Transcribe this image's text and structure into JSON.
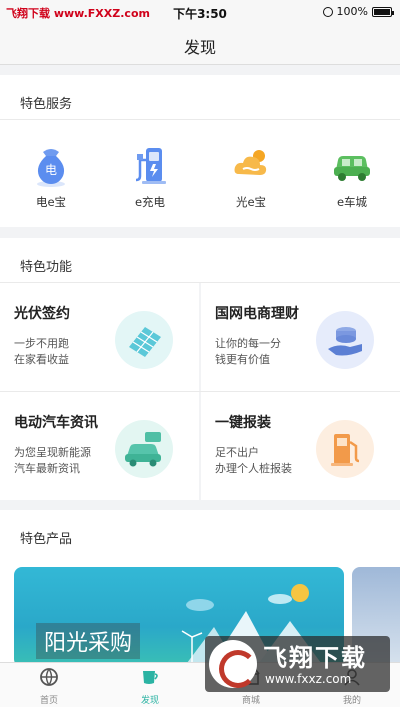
{
  "status_bar": {
    "carrier": "飞翔下载 www.FXXZ.com",
    "time": "下午3:50",
    "battery": "100%"
  },
  "nav": {
    "title": "发现"
  },
  "services": {
    "title": "特色服务",
    "items": [
      {
        "label": "电e宝",
        "icon": "money-bag-icon"
      },
      {
        "label": "e充电",
        "icon": "charging-station-icon"
      },
      {
        "label": "光e宝",
        "icon": "solar-cloud-icon"
      },
      {
        "label": "e车城",
        "icon": "car-icon"
      }
    ]
  },
  "features": {
    "title": "特色功能",
    "items": [
      {
        "title": "光伏签约",
        "desc1": "一步不用跑",
        "desc2": "在家看收益",
        "icon": "solar-panel-icon"
      },
      {
        "title": "国网电商理财",
        "desc1": "让你的每一分",
        "desc2": "钱更有价值",
        "icon": "coins-hand-icon"
      },
      {
        "title": "电动汽车资讯",
        "desc1": "为您呈现新能源",
        "desc2": "汽车最新资讯",
        "icon": "ev-car-icon"
      },
      {
        "title": "一键报装",
        "desc1": "足不出户",
        "desc2": "办理个人桩报装",
        "icon": "fuel-pump-icon"
      }
    ]
  },
  "products": {
    "title": "特色产品",
    "banner_text": "阳光采购"
  },
  "tabs": [
    {
      "label": "首页",
      "icon": "home-globe-icon"
    },
    {
      "label": "发现",
      "icon": "cup-icon",
      "active": true
    },
    {
      "label": "商城",
      "icon": "shop-icon"
    },
    {
      "label": "我的",
      "icon": "user-icon"
    }
  ],
  "watermark": {
    "big": "飞翔下载",
    "small": "www.fxxz.com"
  },
  "colors": {
    "accent": "#2bb3a3",
    "icon_blue": "#5b8def",
    "icon_orange": "#f5a623",
    "icon_green": "#4caf50"
  }
}
